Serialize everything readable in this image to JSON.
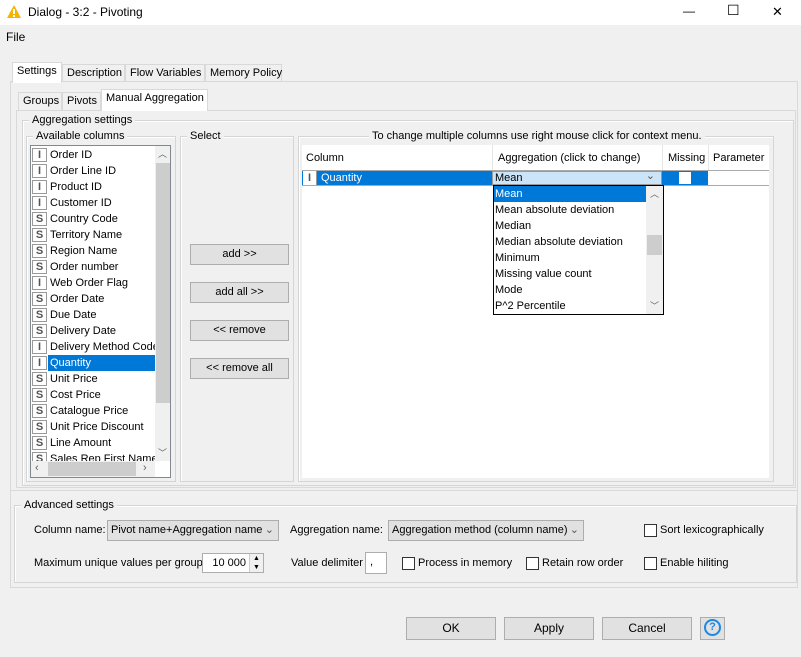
{
  "window": {
    "title": "Dialog - 3:2 - Pivoting",
    "icon": "warning-triangle-icon",
    "minimize": "—",
    "maximize": "☐",
    "close": "✕"
  },
  "menu": {
    "file": "File"
  },
  "tabs": [
    {
      "label": "Settings",
      "active": true
    },
    {
      "label": "Description"
    },
    {
      "label": "Flow Variables"
    },
    {
      "label": "Memory Policy"
    }
  ],
  "subtabs": [
    {
      "label": "Groups"
    },
    {
      "label": "Pivots"
    },
    {
      "label": "Manual Aggregation",
      "active": true
    }
  ],
  "aggregation": {
    "legend": "Aggregation settings",
    "available_legend": "Available columns",
    "columns": [
      {
        "type": "I",
        "name": "Order ID"
      },
      {
        "type": "I",
        "name": "Order Line ID"
      },
      {
        "type": "I",
        "name": "Product ID"
      },
      {
        "type": "I",
        "name": "Customer ID"
      },
      {
        "type": "S",
        "name": "Country Code"
      },
      {
        "type": "S",
        "name": "Territory Name"
      },
      {
        "type": "S",
        "name": "Region Name"
      },
      {
        "type": "S",
        "name": "Order number"
      },
      {
        "type": "I",
        "name": "Web Order Flag"
      },
      {
        "type": "S",
        "name": "Order Date"
      },
      {
        "type": "S",
        "name": "Due Date"
      },
      {
        "type": "S",
        "name": "Delivery Date"
      },
      {
        "type": "I",
        "name": "Delivery Method Code"
      },
      {
        "type": "I",
        "name": "Quantity",
        "selected": true
      },
      {
        "type": "S",
        "name": "Unit Price"
      },
      {
        "type": "S",
        "name": "Cost Price"
      },
      {
        "type": "S",
        "name": "Catalogue Price"
      },
      {
        "type": "S",
        "name": "Unit Price Discount"
      },
      {
        "type": "S",
        "name": "Line Amount"
      },
      {
        "type": "S",
        "name": "Sales Rep First Name"
      }
    ],
    "select_legend": "Select",
    "buttons": {
      "add": "add >>",
      "add_all": "add all >>",
      "remove": "<< remove",
      "remove_all": "<< remove all"
    },
    "hint": "To change multiple columns use right mouse click for context menu.",
    "table": {
      "headers": [
        "Column",
        "Aggregation (click to change)",
        "Missing",
        "Parameter"
      ],
      "rows": [
        {
          "type": "I",
          "column": "Quantity",
          "aggregation": "Mean",
          "missing": false,
          "parameter": ""
        }
      ]
    },
    "dropdown": {
      "options": [
        "Mean",
        "Mean absolute deviation",
        "Median",
        "Median absolute deviation",
        "Minimum",
        "Missing value count",
        "Mode",
        "P^2 Percentile"
      ],
      "selected": "Mean"
    }
  },
  "advanced": {
    "legend": "Advanced settings",
    "column_name_label": "Column name:",
    "column_name_value": "Pivot name+Aggregation name",
    "aggregation_name_label": "Aggregation name:",
    "aggregation_name_value": "Aggregation method (column name)",
    "sort_label": "Sort lexicographically",
    "max_unique_label": "Maximum unique values per group",
    "max_unique_value": "10 000",
    "delimiter_label": "Value delimiter",
    "delimiter_value": ",",
    "process_memory_label": "Process in memory",
    "retain_order_label": "Retain row order",
    "hiliting_label": "Enable hiliting"
  },
  "footer": {
    "ok": "OK",
    "apply": "Apply",
    "cancel": "Cancel",
    "help": "?"
  },
  "colors": {
    "selection": "#0078d7",
    "dropdown_selected_cell": "#cce4f7",
    "warning": "#f5b400"
  }
}
